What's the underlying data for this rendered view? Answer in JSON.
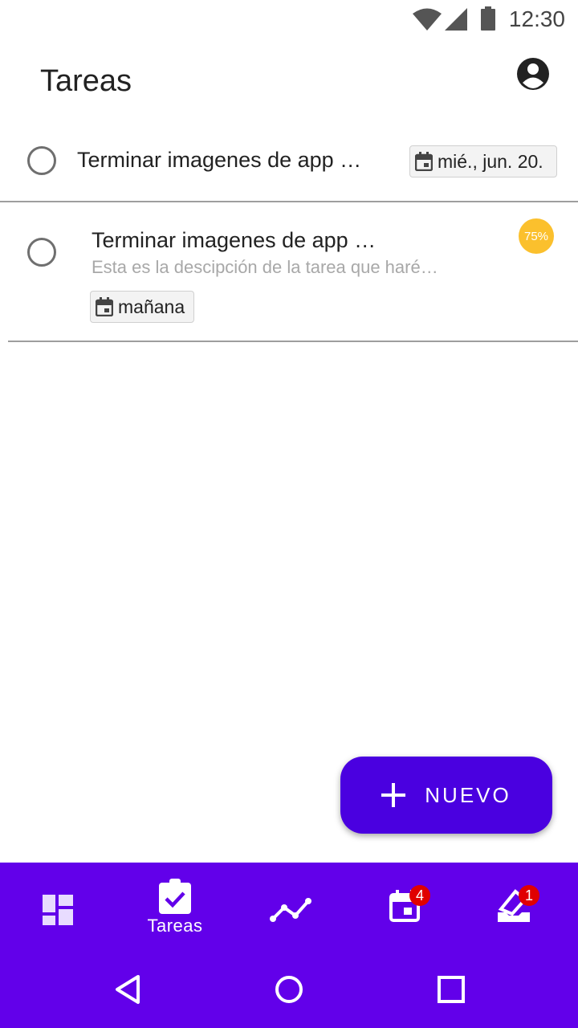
{
  "status_bar": {
    "time": "12:30",
    "icons": [
      "wifi-icon",
      "signal-icon",
      "battery-icon"
    ]
  },
  "header": {
    "title": "Tareas",
    "account_icon": "account-circle-icon"
  },
  "tasks": [
    {
      "title": "Terminar imagenes de app …",
      "date": "mié., jun. 20.",
      "completed": false
    },
    {
      "title": "Terminar imagenes de app …",
      "description": "Esta es la descipción de la tarea que haré…",
      "date": "mañana",
      "progress": "75%",
      "completed": false
    }
  ],
  "fab": {
    "label": "NUEVO",
    "icon": "plus-icon"
  },
  "bottom_nav": {
    "items": [
      {
        "icon": "dashboard-icon",
        "label": ""
      },
      {
        "icon": "task-clipboard-icon",
        "label": "Tareas",
        "active": true
      },
      {
        "icon": "stats-line-icon",
        "label": ""
      },
      {
        "icon": "calendar-icon",
        "label": "",
        "badge": "4"
      },
      {
        "icon": "inbox-edit-icon",
        "label": "",
        "badge": "1"
      }
    ]
  },
  "system_nav": [
    "back-icon",
    "home-icon",
    "recents-icon"
  ],
  "colors": {
    "primary": "#6200ea",
    "fab": "#4a00e0",
    "progress_badge": "#fbc02d",
    "notification_badge": "#e00000"
  }
}
